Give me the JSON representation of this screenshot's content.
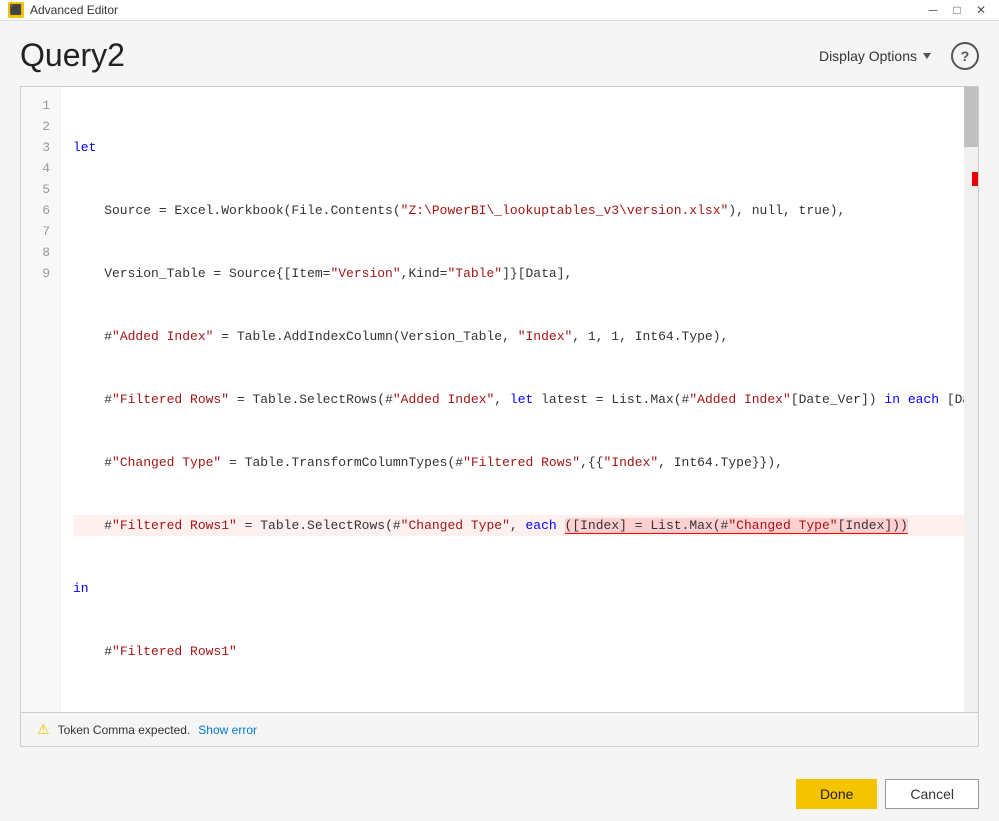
{
  "titleBar": {
    "icon": "⬛",
    "title": "Advanced Editor",
    "minimizeLabel": "─",
    "maximizeLabel": "□",
    "closeLabel": "✕"
  },
  "header": {
    "queryTitle": "Query2",
    "displayOptionsLabel": "Display Options",
    "helpLabel": "?"
  },
  "code": {
    "lines": [
      {
        "num": "1",
        "content": "let",
        "highlight": false
      },
      {
        "num": "2",
        "content": "    Source = Excel.Workbook(File.Contents(\"Z:\\PowerBI\\_lookuptables_v3\\version.xlsx\"), null, true),",
        "highlight": false
      },
      {
        "num": "3",
        "content": "    Version_Table = Source{[Item=\"Version\",Kind=\"Table\"]}[Data],",
        "highlight": false
      },
      {
        "num": "4",
        "content": "    #\"Added Index\" = Table.AddIndexColumn(Version_Table, \"Index\", 1, 1, Int64.Type),",
        "highlight": false
      },
      {
        "num": "5",
        "content": "    #\"Filtered Rows\" = Table.SelectRows(#\"Added Index\", let latest = List.Max(#\"Added Index\"[Date_Ver]) in each [Date_Ver] = latest),",
        "highlight": false
      },
      {
        "num": "6",
        "content": "    #\"Changed Type\" = Table.TransformColumnTypes(#\"Filtered Rows\",{{\"Index\", Int64.Type}}),",
        "highlight": false
      },
      {
        "num": "7",
        "content": "    #\"Filtered Rows1\" = Table.SelectRows(#\"Changed Type\", each ([Index] = List.Max(#\"Changed Type\"[Index])))",
        "highlight": true
      },
      {
        "num": "8",
        "content": "in",
        "highlight": false
      },
      {
        "num": "9",
        "content": "    #\"Filtered Rows1\"",
        "highlight": false
      }
    ]
  },
  "statusBar": {
    "icon": "⚠",
    "message": "Token Comma expected.",
    "showErrorLabel": "Show error"
  },
  "footer": {
    "doneLabel": "Done",
    "cancelLabel": "Cancel"
  }
}
